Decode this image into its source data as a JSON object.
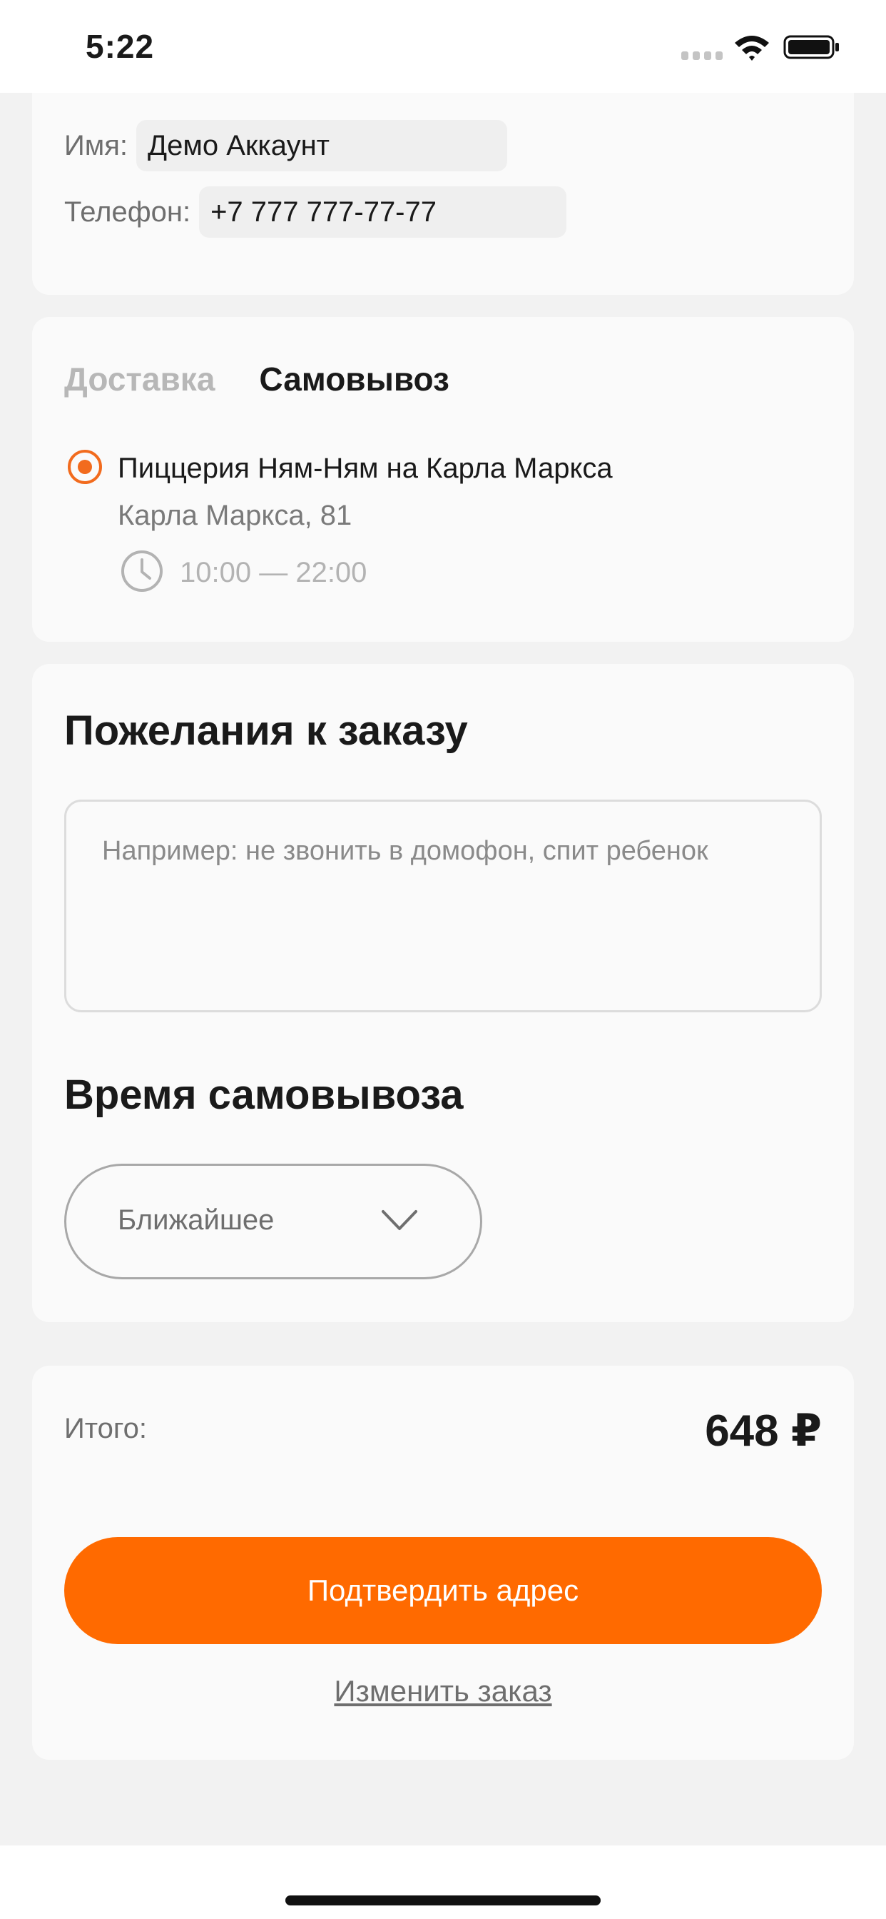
{
  "status_bar": {
    "time": "5:22"
  },
  "contacts": {
    "name_label": "Имя:",
    "name_value": "Демо Аккаунт",
    "phone_label": "Телефон:",
    "phone_value": "+7 777 777-77-77"
  },
  "delivery": {
    "tabs": [
      {
        "label": "Доставка",
        "active": false
      },
      {
        "label": "Самовывоз",
        "active": true
      }
    ],
    "place": {
      "name": "Пиццерия Ням-Ням на Карла Маркса",
      "address": "Карла Маркса, 81",
      "hours": "10:00 — 22:00"
    }
  },
  "wishes": {
    "title": "Пожелания к заказу",
    "placeholder": "Например: не звонить в домофон, спит ребенок",
    "value": ""
  },
  "pickup_time": {
    "title": "Время самовывоза",
    "selected": "Ближайшее"
  },
  "total": {
    "label": "Итого:",
    "value": "648 ₽"
  },
  "actions": {
    "confirm_label": "Подтвердить адрес",
    "change_label": "Изменить заказ"
  },
  "colors": {
    "accent": "#ff6a00",
    "radio": "#f26b1d",
    "background": "#f2f2f2",
    "card": "#fafafa"
  }
}
